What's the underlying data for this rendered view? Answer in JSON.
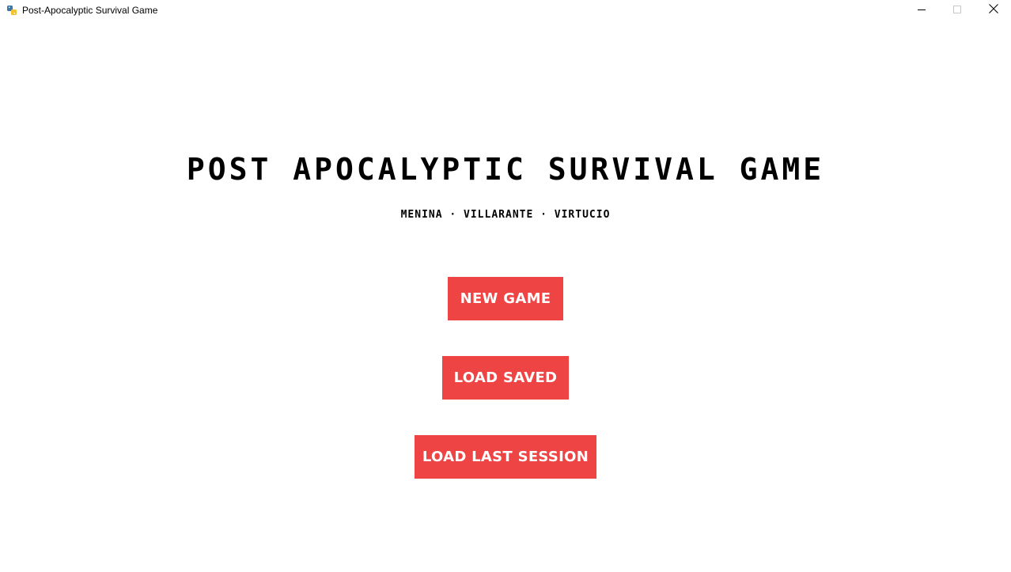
{
  "window": {
    "title": "Post-Apocalyptic Survival Game",
    "icon": "python-icon",
    "controls": {
      "minimize_icon": "minimize-icon",
      "maximize_icon": "maximize-icon",
      "close_icon": "close-icon"
    }
  },
  "main": {
    "title": "POST APOCALYPTIC SURVIVAL GAME",
    "credits": "MENINA · VILLARANTE · VIRTUCIO",
    "buttons": {
      "new_game": "NEW GAME",
      "load_saved": "LOAD SAVED",
      "load_last_session": "LOAD LAST SESSION"
    }
  },
  "colors": {
    "button_bg": "#ef4444",
    "button_text": "#ffffff",
    "background": "#ffffff",
    "text": "#000000"
  }
}
